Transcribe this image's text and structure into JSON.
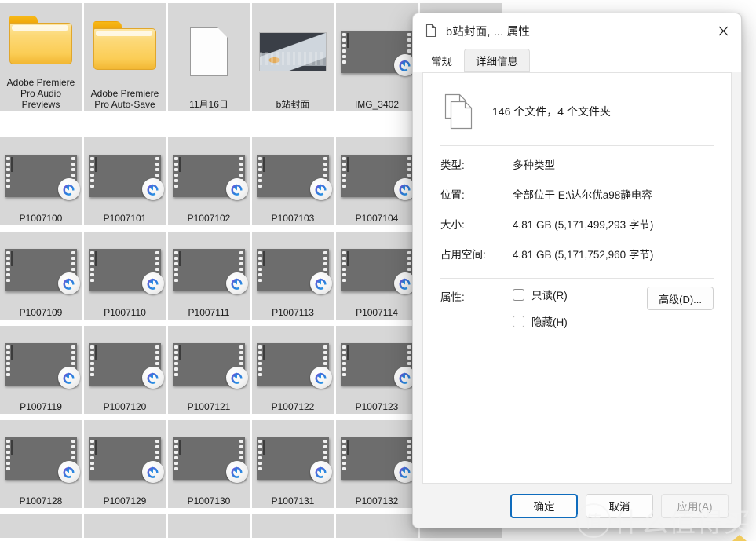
{
  "explorer": {
    "rows": [
      {
        "cells": [
          {
            "label": "Adobe Premiere Pro Audio Previews",
            "kind": "folder"
          },
          {
            "label": "Adobe Premiere Pro Auto-Save",
            "kind": "folder"
          },
          {
            "label": "11月16日",
            "kind": "document"
          },
          {
            "label": "b站封面",
            "kind": "photo",
            "scene": "cover"
          },
          {
            "label": "IMG_3402",
            "kind": "video",
            "scene": "person"
          },
          {
            "label": "",
            "kind": "video",
            "scene": "kbd-a"
          }
        ]
      },
      {
        "cells": [
          {
            "label": "P1007100",
            "kind": "video",
            "scene": "kbd-b"
          },
          {
            "label": "P1007101",
            "kind": "video",
            "scene": "kbd-c"
          },
          {
            "label": "P1007102",
            "kind": "video",
            "scene": "kbd-d"
          },
          {
            "label": "P1007103",
            "kind": "video",
            "scene": "kbd-e"
          },
          {
            "label": "P1007104",
            "kind": "video",
            "scene": "kbd-f"
          },
          {
            "label": "",
            "kind": "video",
            "scene": "kbd-a"
          }
        ]
      },
      {
        "cells": [
          {
            "label": "P1007109",
            "kind": "video",
            "scene": "kbd-g"
          },
          {
            "label": "P1007110",
            "kind": "video",
            "scene": "kbd-h"
          },
          {
            "label": "P1007111",
            "kind": "video",
            "scene": "kbd-i"
          },
          {
            "label": "P1007113",
            "kind": "video",
            "scene": "kbd-j"
          },
          {
            "label": "P1007114",
            "kind": "video",
            "scene": "kbd-k"
          },
          {
            "label": "",
            "kind": "video",
            "scene": "kbd-b"
          }
        ]
      },
      {
        "cells": [
          {
            "label": "P1007119",
            "kind": "video",
            "scene": "kbd-l"
          },
          {
            "label": "P1007120",
            "kind": "video",
            "scene": "kbd-m"
          },
          {
            "label": "P1007121",
            "kind": "video",
            "scene": "hands-a"
          },
          {
            "label": "P1007122",
            "kind": "video",
            "scene": "hands-b"
          },
          {
            "label": "P1007123",
            "kind": "video",
            "scene": "hands-c"
          },
          {
            "label": "",
            "kind": "video",
            "scene": "kbd-c"
          }
        ]
      },
      {
        "cells": [
          {
            "label": "P1007128",
            "kind": "video",
            "scene": "hands-d"
          },
          {
            "label": "P1007129",
            "kind": "video",
            "scene": "hands-e"
          },
          {
            "label": "P1007130",
            "kind": "video",
            "scene": "kbd-n"
          },
          {
            "label": "P1007131",
            "kind": "video",
            "scene": "hands-f"
          },
          {
            "label": "P1007132",
            "kind": "video",
            "scene": "hands-g"
          },
          {
            "label": "",
            "kind": "video",
            "scene": "kbd-d"
          }
        ]
      },
      {
        "cells": [
          {
            "label": "",
            "kind": "empty"
          },
          {
            "label": "",
            "kind": "empty"
          },
          {
            "label": "",
            "kind": "empty"
          },
          {
            "label": "",
            "kind": "empty"
          },
          {
            "label": "",
            "kind": "empty"
          },
          {
            "label": "",
            "kind": "empty"
          }
        ]
      }
    ]
  },
  "dialog": {
    "title": "b站封面, ... 属性",
    "close_label": "✕",
    "tabs": [
      {
        "label": "常规",
        "active": true
      },
      {
        "label": "详细信息",
        "active": false
      }
    ],
    "summary": "146 个文件，4 个文件夹",
    "properties": [
      {
        "key": "类型:",
        "value": "多种类型"
      },
      {
        "key": "位置:",
        "value": "全部位于 E:\\达尔优a98静电容"
      },
      {
        "key": "大小:",
        "value": "4.81 GB (5,171,499,293 字节)"
      },
      {
        "key": "占用空间:",
        "value": "4.81 GB (5,171,752,960 字节)"
      }
    ],
    "attributes": {
      "key": "属性:",
      "checkboxes": [
        {
          "label": "只读(R)",
          "checked": false
        },
        {
          "label": "隐藏(H)",
          "checked": false
        }
      ],
      "advanced_label": "高级(D)..."
    },
    "footer": {
      "ok": "确定",
      "cancel": "取消",
      "apply": "应用(A)"
    },
    "accent": "#0f6cbd"
  },
  "watermark": {
    "mark": "值",
    "text": "什么值得买"
  }
}
